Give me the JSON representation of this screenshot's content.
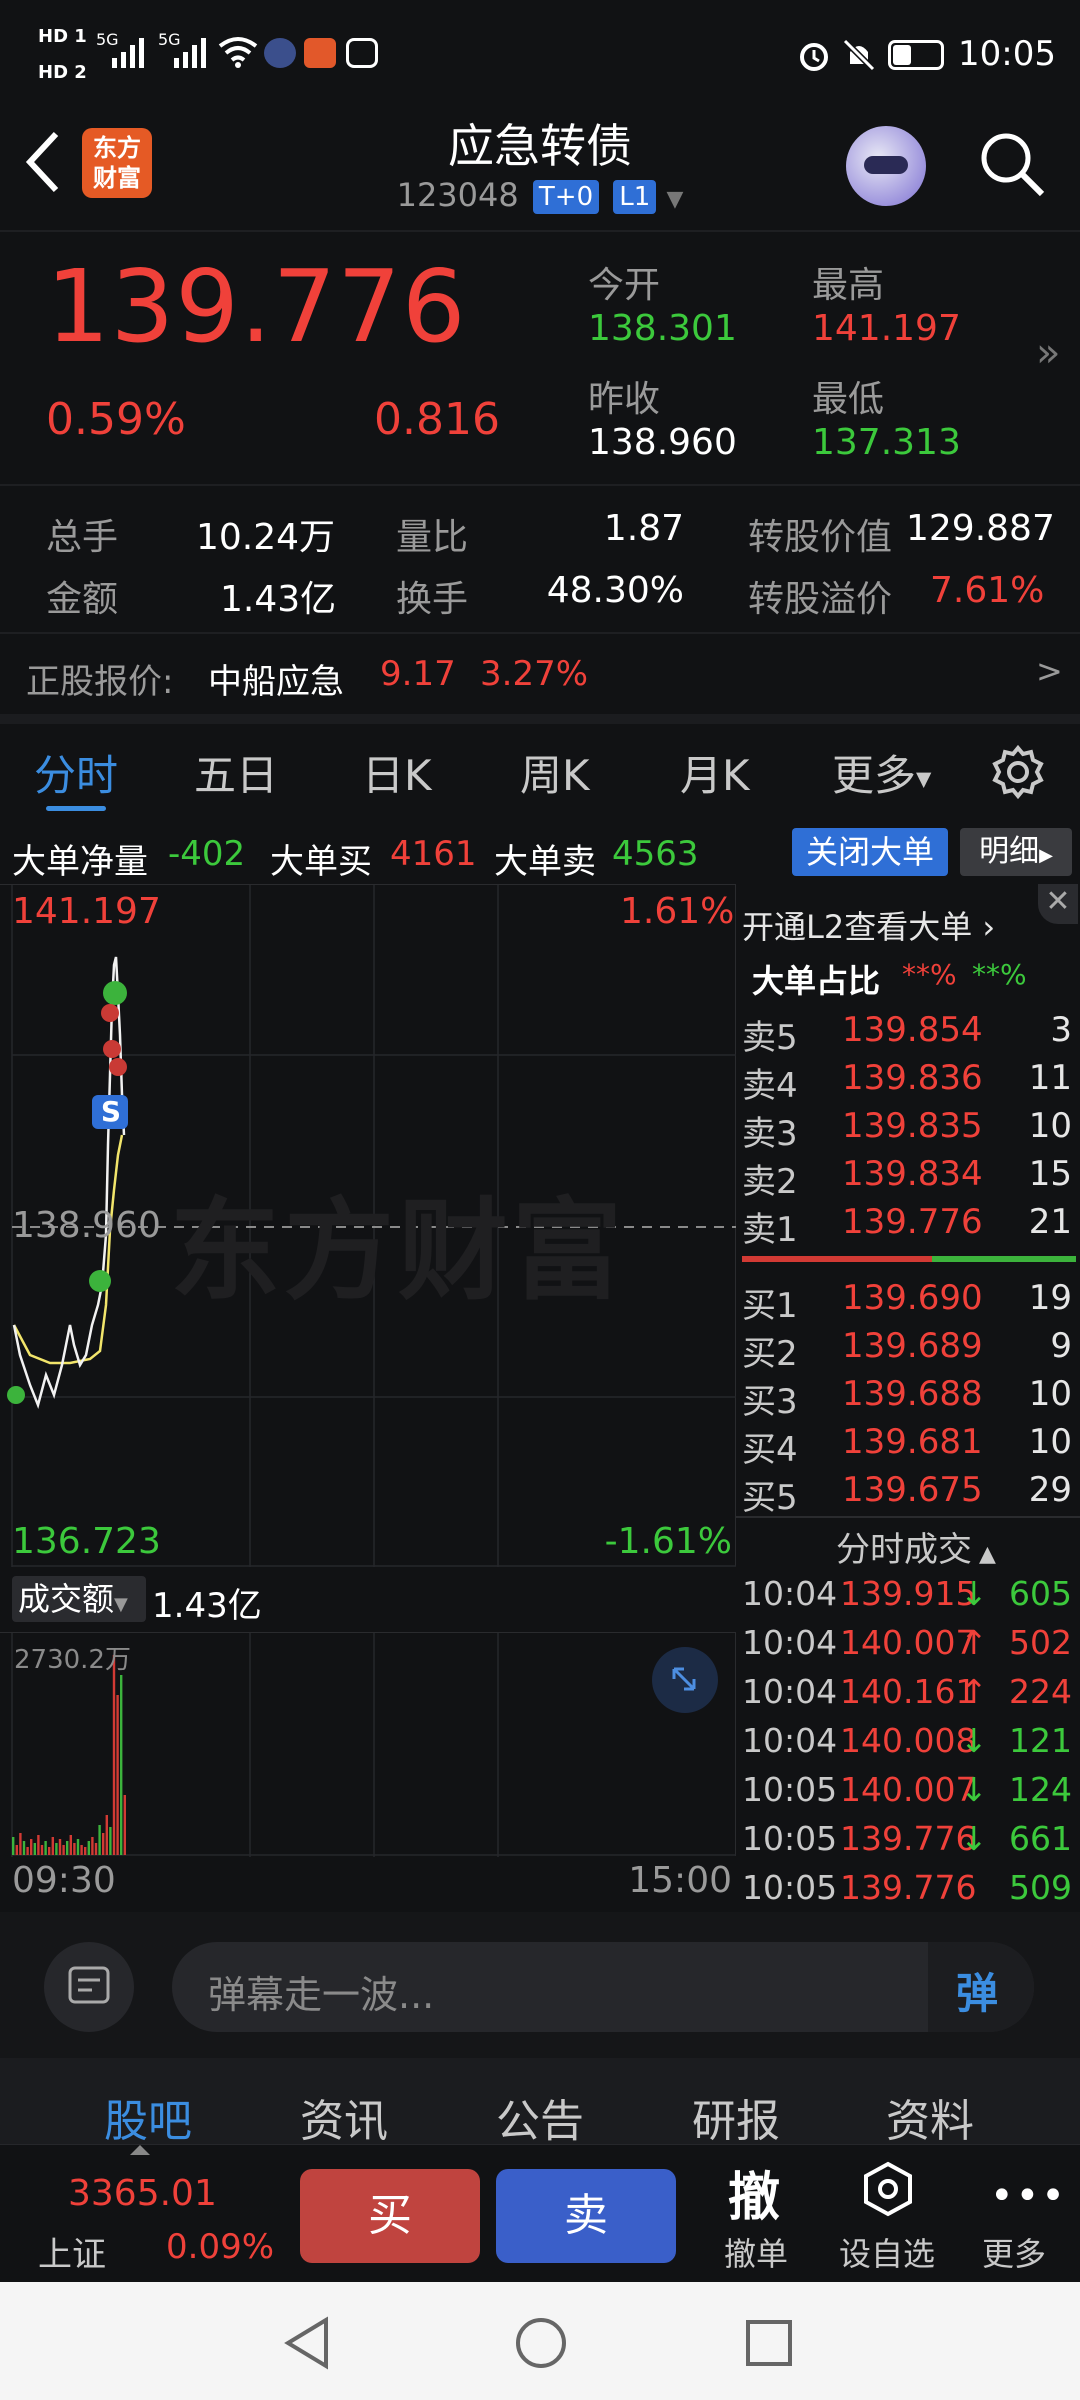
{
  "status_bar": {
    "sim1": "HD 1",
    "sim2": "HD 2",
    "net1": "5G",
    "net2": "5G",
    "time": "10:05"
  },
  "header": {
    "title": "应急转债",
    "code": "123048",
    "tag1": "T+0",
    "tag2": "L1",
    "logo_line1": "东方",
    "logo_line2": "财富"
  },
  "quote": {
    "price": "139.776",
    "change_pct": "0.59%",
    "change": "0.816",
    "open_label": "今开",
    "open": "138.301",
    "high_label": "最高",
    "high": "141.197",
    "prev_close_label": "昨收",
    "prev_close": "138.960",
    "low_label": "最低",
    "low": "137.313"
  },
  "stats": {
    "volume_label": "总手",
    "volume": "10.24万",
    "ratio_label": "量比",
    "ratio": "1.87",
    "conv_value_label": "转股价值",
    "conv_value": "129.887",
    "amount_label": "金额",
    "amount": "1.43亿",
    "turnover_label": "换手",
    "turnover": "48.30%",
    "premium_label": "转股溢价",
    "premium": "7.61%"
  },
  "underlying": {
    "label": "正股报价:",
    "name": "中船应急",
    "price": "9.17",
    "pct": "3.27%",
    "arrow": ">"
  },
  "tabs": [
    "分时",
    "五日",
    "日K",
    "周K",
    "月K",
    "更多"
  ],
  "big_orders": {
    "net_label": "大单净量",
    "net": "-402",
    "buy_label": "大单买",
    "buy": "4161",
    "sell_label": "大单卖",
    "sell": "4563",
    "close_btn": "关闭大单",
    "detail_btn": "明细"
  },
  "chart": {
    "top_price": "141.197",
    "top_pct": "1.61%",
    "mid_price": "138.960",
    "bottom_price": "136.723",
    "bottom_pct": "-1.61%",
    "watermark": "东方财富",
    "marker": "S"
  },
  "volume_panel": {
    "selector": "成交额",
    "value": "1.43亿",
    "max_label": "2730.2万",
    "start_time": "09:30",
    "end_time": "15:00"
  },
  "order_book": {
    "l2_link": "开通L2查看大单",
    "ratio_label": "大单占比",
    "ratio_red": "**%",
    "ratio_green": "**%",
    "asks": [
      {
        "label": "卖5",
        "price": "139.854",
        "vol": "3"
      },
      {
        "label": "卖4",
        "price": "139.836",
        "vol": "11"
      },
      {
        "label": "卖3",
        "price": "139.835",
        "vol": "10"
      },
      {
        "label": "卖2",
        "price": "139.834",
        "vol": "15"
      },
      {
        "label": "卖1",
        "price": "139.776",
        "vol": "21"
      }
    ],
    "bids": [
      {
        "label": "买1",
        "price": "139.690",
        "vol": "19"
      },
      {
        "label": "买2",
        "price": "139.689",
        "vol": "9"
      },
      {
        "label": "买3",
        "price": "139.688",
        "vol": "10"
      },
      {
        "label": "买4",
        "price": "139.681",
        "vol": "10"
      },
      {
        "label": "买5",
        "price": "139.675",
        "vol": "29"
      }
    ]
  },
  "trades": {
    "title": "分时成交",
    "rows": [
      {
        "time": "10:04",
        "price": "139.915",
        "dir": "↓",
        "vol": "605",
        "color": "green"
      },
      {
        "time": "10:04",
        "price": "140.007",
        "dir": "↑",
        "vol": "502",
        "color": "red"
      },
      {
        "time": "10:04",
        "price": "140.161",
        "dir": "↑",
        "vol": "224",
        "color": "red"
      },
      {
        "time": "10:04",
        "price": "140.008",
        "dir": "↓",
        "vol": "121",
        "color": "green"
      },
      {
        "time": "10:05",
        "price": "140.007",
        "dir": "↓",
        "vol": "124",
        "color": "green"
      },
      {
        "time": "10:05",
        "price": "139.776",
        "dir": "↓",
        "vol": "661",
        "color": "green"
      },
      {
        "time": "10:05",
        "price": "139.776",
        "dir": "",
        "vol": "509",
        "color": "green"
      }
    ]
  },
  "comment": {
    "placeholder": "弹幕走一波...",
    "send": "弹"
  },
  "bottom_tabs": [
    "股吧",
    "资讯",
    "公告",
    "研报",
    "资料"
  ],
  "action_bar": {
    "index_value": "3365.01",
    "index_name": "上证",
    "index_pct": "0.09%",
    "buy": "买",
    "sell": "卖",
    "cancel_glyph": "撤",
    "cancel_label": "撤单",
    "watch_label": "设自选",
    "more_label": "更多"
  },
  "colors": {
    "up": "#f0413a",
    "down": "#3cc93c",
    "accent": "#2f6fd6",
    "buy_btn": "#c0443f",
    "sell_btn": "#3a5fc9"
  }
}
